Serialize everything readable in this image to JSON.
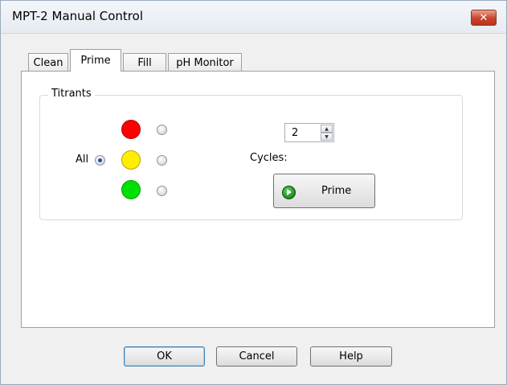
{
  "window": {
    "title": "MPT-2 Manual Control",
    "close_glyph": "✕"
  },
  "tabs": [
    {
      "label": "Clean",
      "active": false
    },
    {
      "label": "Prime",
      "active": true
    },
    {
      "label": "Fill",
      "active": false
    },
    {
      "label": "pH Monitor",
      "active": false
    }
  ],
  "titrants": {
    "group_label": "Titrants",
    "all_label": "All",
    "all_selected": true,
    "colors": {
      "red": "#ff0000",
      "yellow": "#ffee00",
      "green": "#00e000"
    }
  },
  "cycles": {
    "label": "Cycles:",
    "value": "2",
    "up_glyph": "▲",
    "down_glyph": "▼"
  },
  "prime_button": {
    "label": "Prime",
    "icon": "play-icon"
  },
  "footer": {
    "ok_label": "OK",
    "cancel_label": "Cancel",
    "help_label": "Help"
  }
}
